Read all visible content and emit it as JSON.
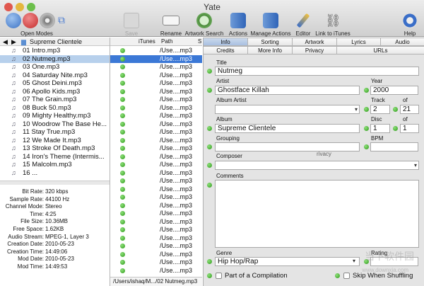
{
  "window": {
    "title": "Yate"
  },
  "toolbar": {
    "open_modes": "Open Modes",
    "save": "Save",
    "rename": "Rename",
    "artwork_search": "Artwork Search",
    "actions": "Actions",
    "manage_actions": "Manage Actions",
    "editor": "Editor",
    "link_itunes": "Link to iTunes",
    "help": "Help"
  },
  "breadcrumb": {
    "folder": "Supreme Clientele"
  },
  "files": [
    "01 Intro.mp3",
    "02 Nutmeg.mp3",
    "03 One.mp3",
    "04 Saturday Nite.mp3",
    "05 Ghost Deini.mp3",
    "06 Apollo Kids.mp3",
    "07 The Grain.mp3",
    "08 Buck 50.mp3",
    "09 Mighty Healthy.mp3",
    "10 Woodrow The Base He...",
    "11 Stay True.mp3",
    "12 We Made It.mp3",
    "13 Stroke Of Death.mp3",
    "14 Iron's Theme (Intermis...",
    "15 Malcolm.mp3",
    "16 ..."
  ],
  "properties": [
    {
      "k": "Bit Rate:",
      "v": "320 kbps"
    },
    {
      "k": "Sample Rate:",
      "v": "44100 Hz"
    },
    {
      "k": "Channel Mode:",
      "v": "Stereo"
    },
    {
      "k": "Time:",
      "v": "4:25"
    },
    {
      "k": "File Size:",
      "v": "10.36MB"
    },
    {
      "k": "Free Space:",
      "v": "1.62KB"
    },
    {
      "k": "Audio Stream:",
      "v": "MPEG-1, Layer 3"
    },
    {
      "k": "Creation Date:",
      "v": "2010-05-23"
    },
    {
      "k": "Creation Time:",
      "v": "14:49:06"
    },
    {
      "k": "Mod Date:",
      "v": "2010-05-23"
    },
    {
      "k": "Mod Time:",
      "v": "14:49:53"
    }
  ],
  "table": {
    "headers": {
      "itunes": "iTunes",
      "path": "Path",
      "s": "S"
    },
    "row_path": "/Use....mp3",
    "status": "/Users/ishaq/M.../02 Nutmeg.mp3"
  },
  "tabs_row1": [
    "Info",
    "Sorting",
    "Artwork",
    "Lyrics",
    "Audio"
  ],
  "tabs_row2": [
    "Credits",
    "More Info",
    "Privacy",
    "URLs"
  ],
  "editor": {
    "title_label": "Title",
    "title_value": "Nutmeg",
    "artist_label": "Artist",
    "artist_value": "Ghostface Killah",
    "year_label": "Year",
    "year_value": "2000",
    "album_artist_label": "Album Artist",
    "track_label": "Track",
    "track_value": "2",
    "of1": "of",
    "track_total": "21",
    "album_label": "Album",
    "album_value": "Supreme Clientele",
    "disc_label": "Disc",
    "disc_value": "1",
    "of2": "of",
    "disc_total": "1",
    "grouping_label": "Grouping",
    "bpm_label": "BPM",
    "privacy_ghost": "rivacy",
    "composer_label": "Composer",
    "comments_label": "Comments",
    "genre_label": "Genre",
    "genre_value": "Hip Hop/Rap",
    "rating_label": "Rating",
    "compilation_label": "Part of a Compilation",
    "skip_label": "Skip When Shuffling"
  },
  "watermark": {
    "main": "当下软件园",
    "sub": "www.downxia.com"
  },
  "colors": {
    "selection": "#3b78d6",
    "file_selection": "#b7d0ec",
    "status_dot": "#2e9a1a"
  }
}
